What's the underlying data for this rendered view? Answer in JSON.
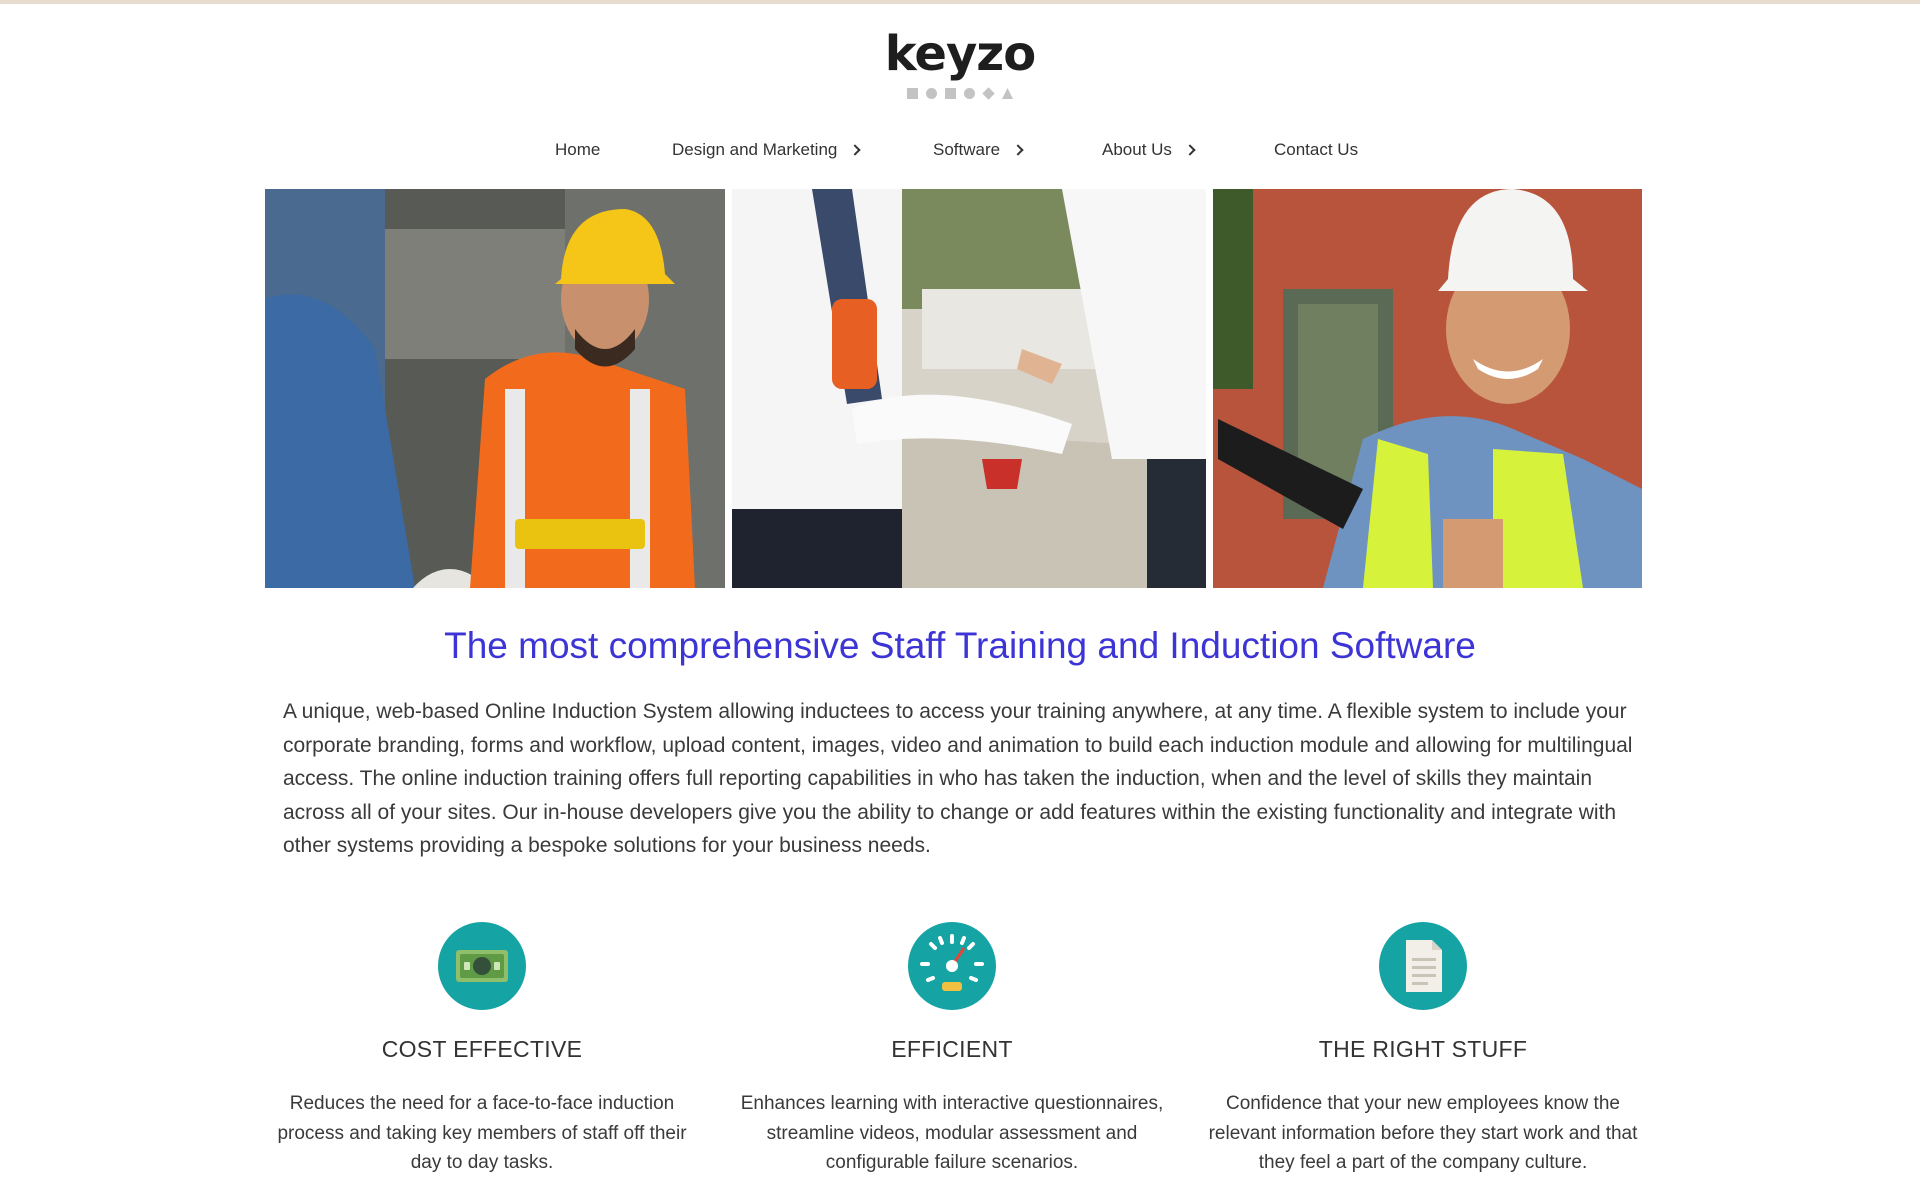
{
  "brand": {
    "name": "keyzo"
  },
  "nav": {
    "items": [
      {
        "label": "Home",
        "has_submenu": false
      },
      {
        "label": "Design and Marketing",
        "has_submenu": true
      },
      {
        "label": "Software",
        "has_submenu": true
      },
      {
        "label": "About Us",
        "has_submenu": true
      },
      {
        "label": "Contact Us",
        "has_submenu": false
      }
    ]
  },
  "main": {
    "headline": "The most comprehensive Staff Training and Induction Software",
    "lead": "A unique, web-based Online Induction System allowing inductees to access your training anywhere, at any time. A flexible system to include your corporate branding, forms and workflow, upload content, images, video and animation to build each induction module and allowing for multilingual access. The online induction training offers full reporting capabilities in who has taken the induction, when and the level of skills they maintain across all of your sites. Our in-house developers give you the ability to change or add features within the existing functionality and integrate with other systems providing a bespoke solutions for your business needs."
  },
  "features": [
    {
      "icon": "money-icon",
      "title": "COST EFFECTIVE",
      "text": "Reduces the need for a face-to-face induction process and taking key members of staff off their day to day tasks."
    },
    {
      "icon": "speedometer-icon",
      "title": "EFFICIENT",
      "text": "Enhances learning with interactive questionnaires, streamline videos, modular assessment and configurable failure scenarios."
    },
    {
      "icon": "document-icon",
      "title": "THE RIGHT STUFF",
      "text": "Confidence that your new employees know the relevant information before they start work and that they feel a part of the company culture."
    }
  ],
  "colors": {
    "accent_teal": "#16a3a3",
    "headline_blue": "#3d34d6"
  }
}
